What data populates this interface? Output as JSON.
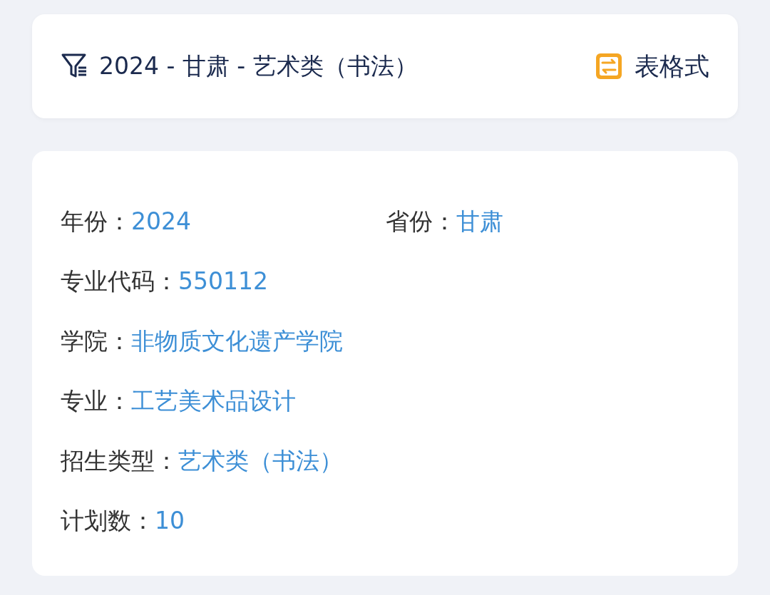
{
  "filter_bar": {
    "title": "2024 - 甘肃 - 艺术类（书法）",
    "toggle_label": "表格式"
  },
  "detail_card": {
    "rows": [
      [
        {
          "label": "年份：",
          "value": "2024"
        },
        {
          "label": "省份：",
          "value": "甘肃"
        }
      ],
      [
        {
          "label": "专业代码：",
          "value": "550112"
        }
      ],
      [
        {
          "label": "学院：",
          "value": "非物质文化遗产学院"
        }
      ],
      [
        {
          "label": "专业：",
          "value": "工艺美术品设计"
        }
      ],
      [
        {
          "label": "招生类型：",
          "value": "艺术类（书法）"
        }
      ],
      [
        {
          "label": "计划数：",
          "value": "10"
        }
      ]
    ]
  }
}
